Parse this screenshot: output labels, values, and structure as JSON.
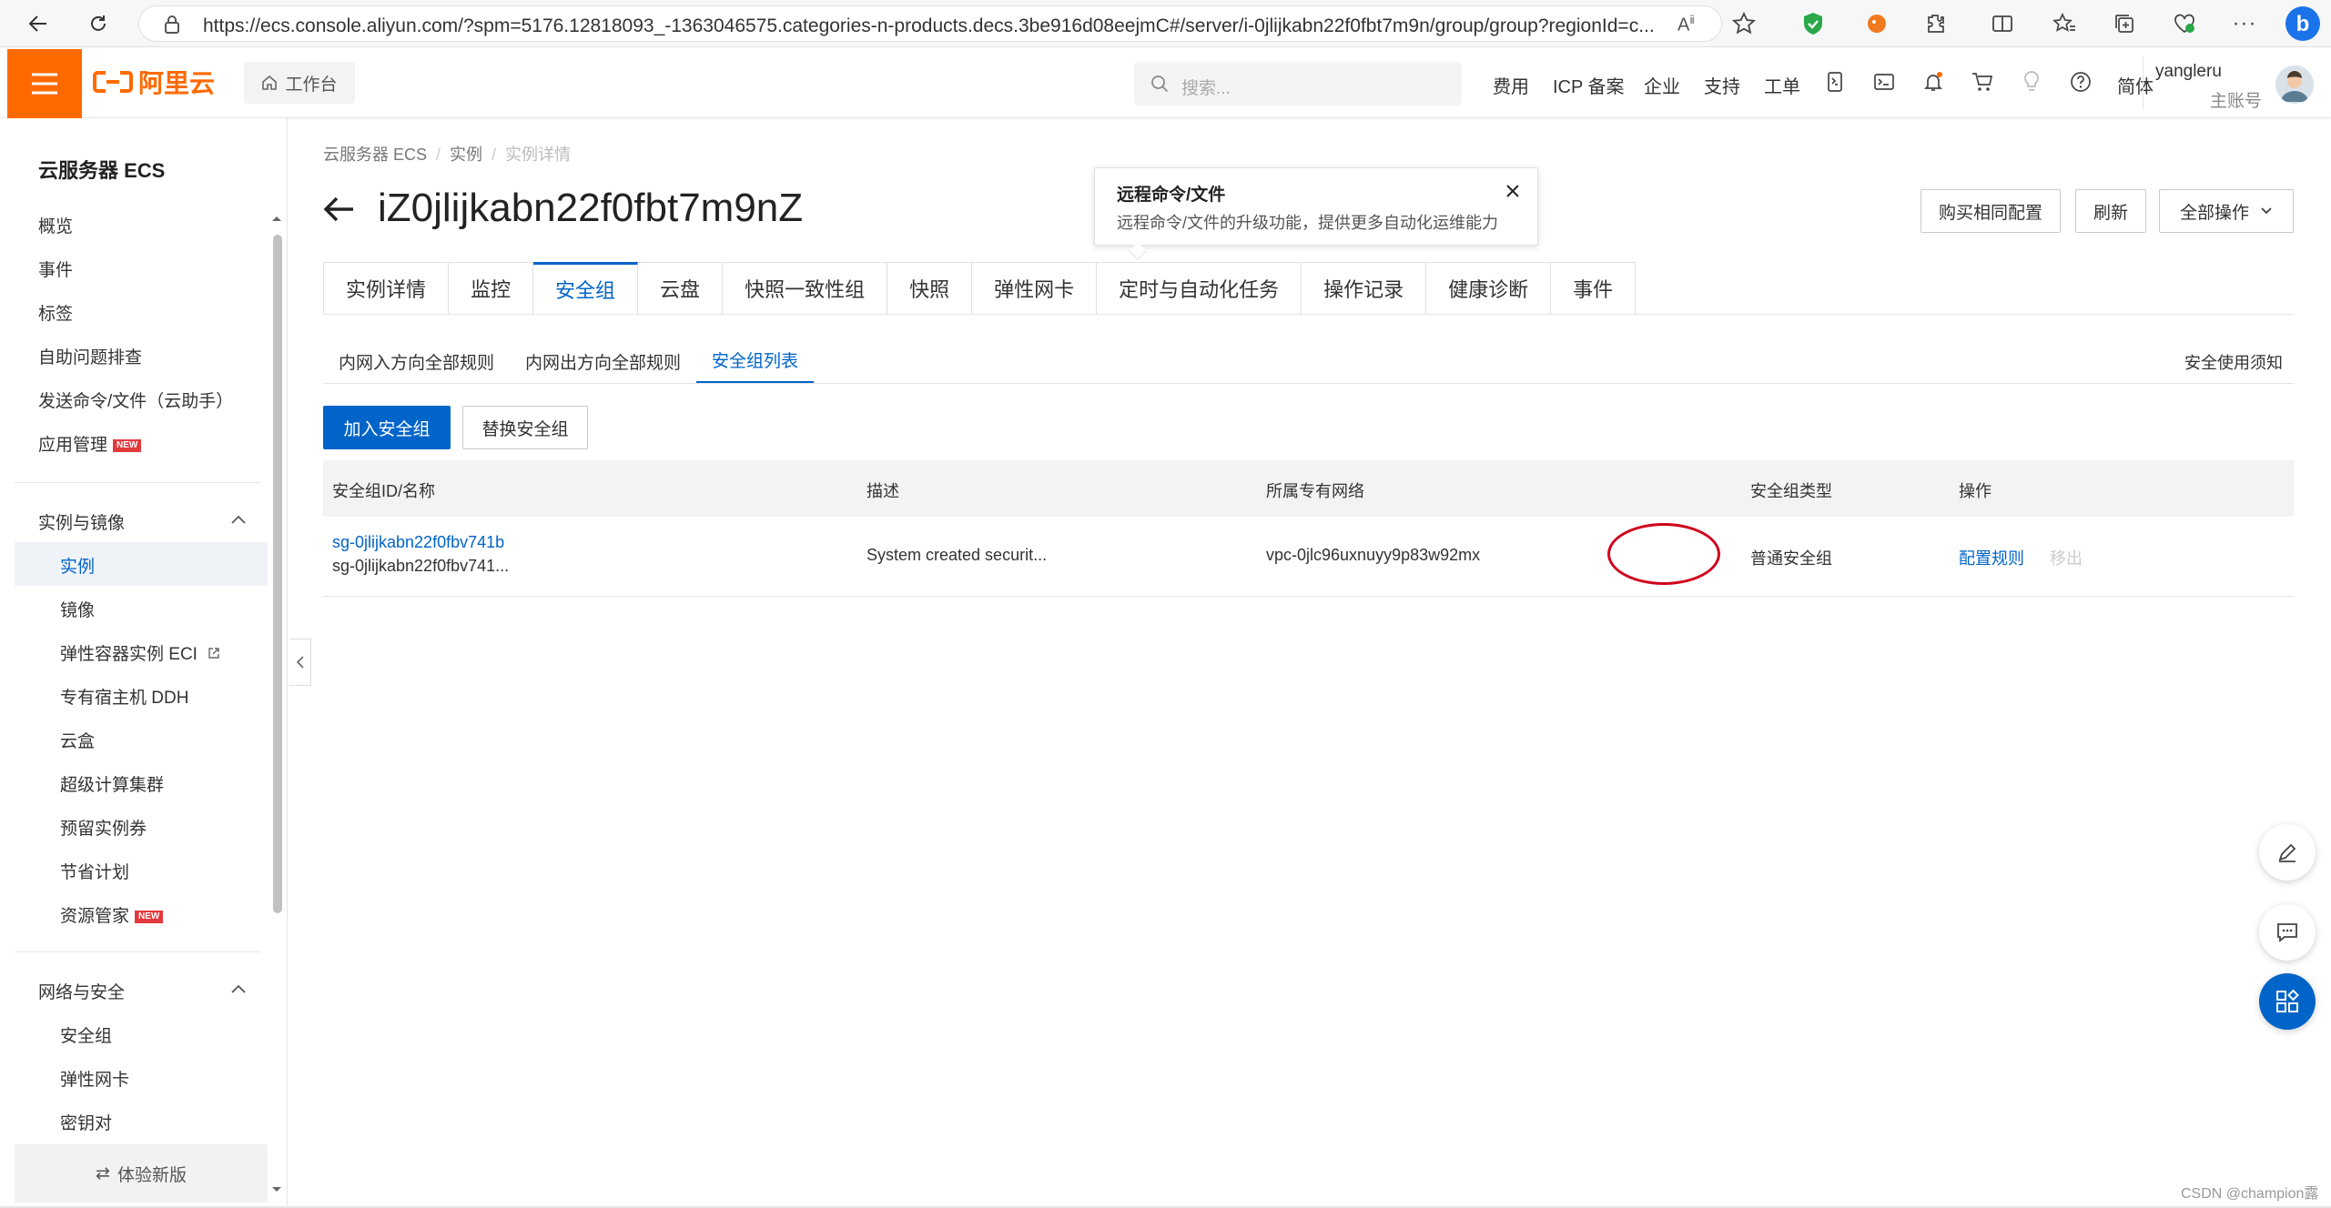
{
  "browser": {
    "url": "https://ecs.console.aliyun.com/?spm=5176.12818093_-1363046575.categories-n-products.decs.3be916d08eejmC#/server/i-0jlijkabn22f0fbt7m9n/group/group?regionId=c..."
  },
  "topbar": {
    "logo_text": "阿里云",
    "workbench_label": "工作台",
    "search_placeholder": "搜索...",
    "links": [
      "费用",
      "ICP 备案",
      "企业",
      "支持",
      "工单"
    ],
    "language": "简体",
    "user_name": "yangleru",
    "user_role": "主账号"
  },
  "sidebar": {
    "title": "云服务器 ECS",
    "top_items": [
      "概览",
      "事件",
      "标签",
      "自助问题排查",
      "发送命令/文件（云助手）",
      "应用管理"
    ],
    "new_badge": "NEW",
    "section1": {
      "title": "实例与镜像",
      "items": [
        "实例",
        "镜像",
        "弹性容器实例 ECI",
        "专有宿主机 DDH",
        "云盒",
        "超级计算集群",
        "预留实例券",
        "节省计划",
        "资源管家"
      ]
    },
    "section2": {
      "title": "网络与安全",
      "items": [
        "安全组",
        "弹性网卡",
        "密钥对"
      ]
    },
    "footer_label": "体验新版"
  },
  "breadcrumb": [
    "云服务器 ECS",
    "实例",
    "实例详情"
  ],
  "page_title": "iZ0jlijkabn22f0fbt7m9nZ",
  "tooltip": {
    "title": "远程命令/文件",
    "desc": "远程命令/文件的升级功能，提供更多自动化运维能力"
  },
  "header_buttons": {
    "buy_same": "购买相同配置",
    "refresh": "刷新",
    "all_actions": "全部操作"
  },
  "tabs": [
    "实例详情",
    "监控",
    "安全组",
    "云盘",
    "快照一致性组",
    "快照",
    "弹性网卡",
    "定时与自动化任务",
    "操作记录",
    "健康诊断",
    "事件"
  ],
  "active_tab": 2,
  "subtabs": [
    "内网入方向全部规则",
    "内网出方向全部规则",
    "安全组列表"
  ],
  "safety_notice": "安全使用须知",
  "actions": {
    "join": "加入安全组",
    "replace": "替换安全组"
  },
  "table": {
    "columns": [
      "安全组ID/名称",
      "描述",
      "所属专有网络",
      "安全组类型",
      "操作"
    ],
    "rows": [
      {
        "id": "sg-0jlijkabn22f0fbv741b",
        "name": "sg-0jlijkabn22f0fbv741...",
        "desc": "System created securit...",
        "vpc": "vpc-0jlc96uxnuyy9p83w92mx",
        "type": "普通安全组",
        "op_config": "配置规则",
        "op_remove": "移出"
      }
    ]
  },
  "watermark": "CSDN @champion露",
  "colors": {
    "brand_orange": "#ff6a00",
    "primary_blue": "#0064c8",
    "highlight_red": "#d0021b"
  }
}
